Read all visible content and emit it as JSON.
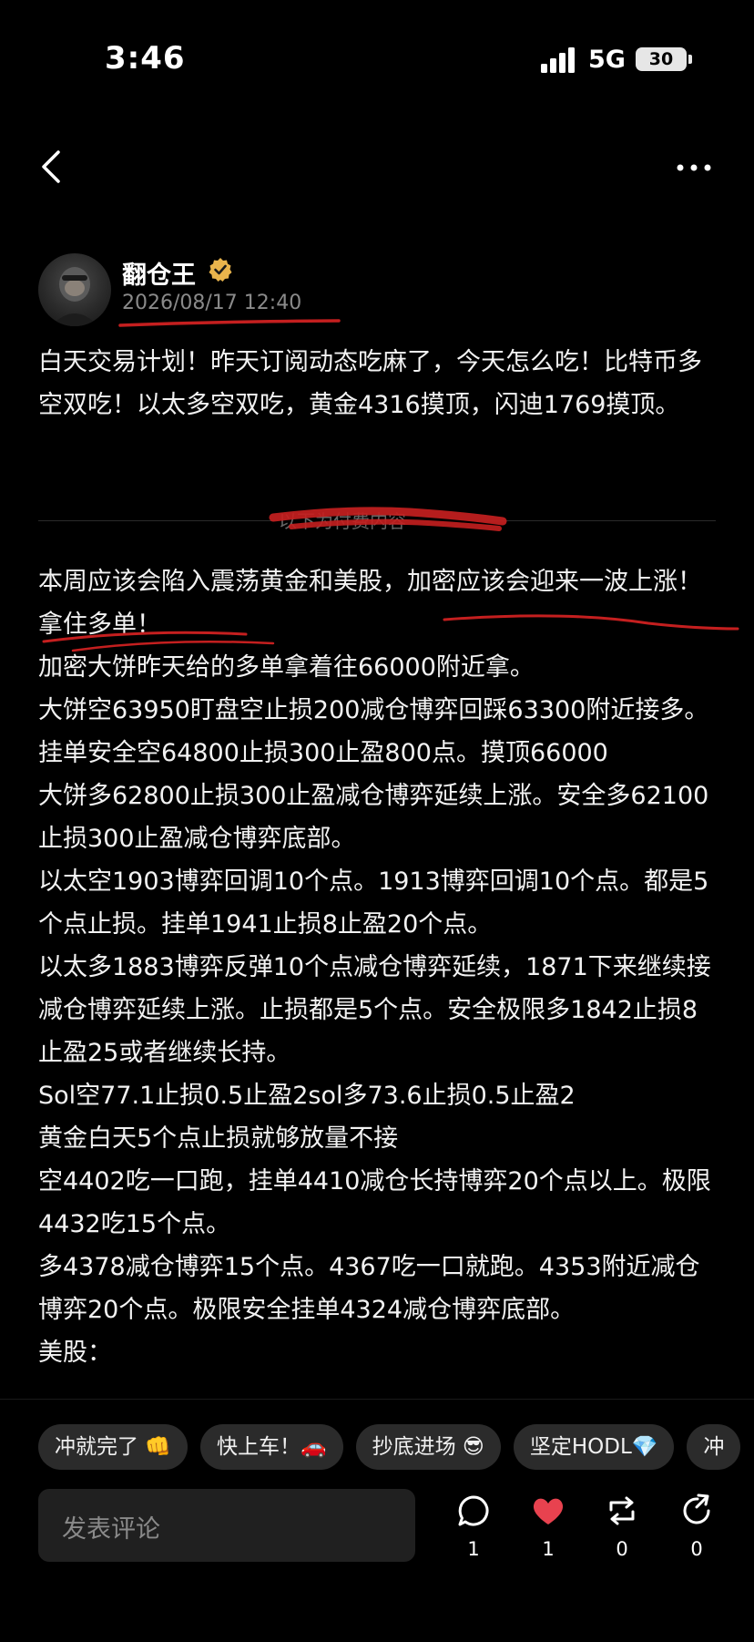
{
  "status_bar": {
    "time": "3:46",
    "network": "5G",
    "battery": "30"
  },
  "nav": {
    "back_icon": "chevron-left-icon",
    "more_icon": "more-dots-icon"
  },
  "author": {
    "name": "翻仓王",
    "verified": true,
    "timestamp": "2026/08/17 12:40"
  },
  "post": {
    "intro": "白天交易计划！昨天订阅动态吃麻了，今天怎么吃！比特币多空双吃！以太多空双吃，黄金4316摸顶，闪迪1769摸顶。",
    "divider_text": "以下为付费内容",
    "lines": [
      "本周应该会陷入震荡黄金和美股，加密应该会迎来一波上涨！拿住多单！",
      "加密大饼昨天给的多单拿着往66000附近拿。",
      "大饼空63950盯盘空止损200减仓博弈回踩63300附近接多。挂单安全空64800止损300止盈800点。摸顶66000",
      "大饼多62800止损300止盈减仓博弈延续上涨。安全多62100止损300止盈减仓博弈底部。",
      "以太空1903博弈回调10个点。1913博弈回调10个点。都是5个点止损。挂单1941止损8止盈20个点。",
      "以太多1883博弈反弹10个点减仓博弈延续，1871下来继续接减仓博弈延续上涨。止损都是5个点。安全极限多1842止损8止盈25或者继续长持。",
      "Sol空77.1止损0.5止盈2sol多73.6止损0.5止盈2",
      "黄金白天5个点止损就够放量不接",
      "空4402吃一口跑，挂单4410减仓长持博弈20个点以上。极限4432吃15个点。",
      "多4378减仓博弈15个点。4367吃一口就跑。4353附近减仓博弈20个点。极限安全挂单4324减仓博弈底部。",
      "美股："
    ]
  },
  "quick_replies": [
    "冲就完了 👊",
    "快上车！🚗",
    "抄底进场 😎",
    "坚定HODL💎",
    "冲"
  ],
  "comment_box": {
    "placeholder": "发表评论"
  },
  "actions": [
    {
      "name": "comment",
      "icon": "comment-bubble-icon",
      "count": "1"
    },
    {
      "name": "like",
      "icon": "heart-icon",
      "count": "1",
      "color": "#e8424f"
    },
    {
      "name": "repost",
      "icon": "repost-icon",
      "count": "0"
    },
    {
      "name": "share",
      "icon": "share-icon",
      "count": "0"
    }
  ],
  "colors": {
    "background": "#000000",
    "annotation_red": "#c41f1f",
    "verified_gold": "#e9b44c"
  }
}
